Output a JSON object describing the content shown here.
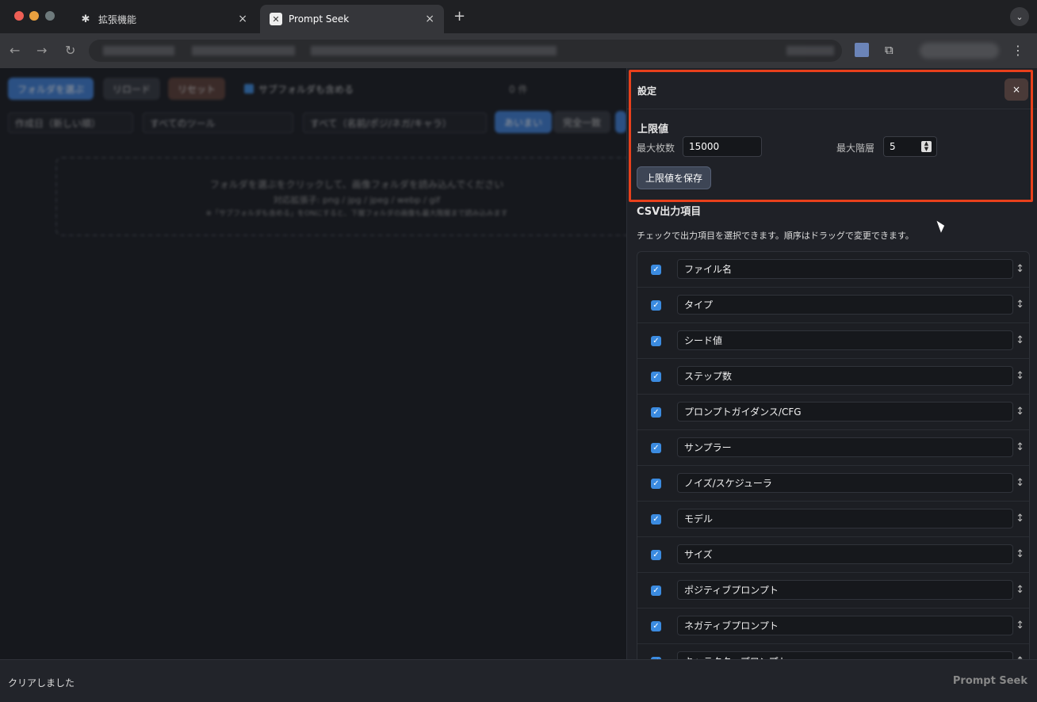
{
  "browser": {
    "tabs": [
      {
        "label": "拡張機能",
        "icon": "puzzle-icon"
      },
      {
        "label": "Prompt Seek",
        "icon": "prompt-seek-icon"
      }
    ],
    "new_tab": "+",
    "tab_close": "×"
  },
  "app_toolbar": {
    "choose_folder": "フォルダを選ぶ",
    "reload": "リロード",
    "reset": "リセット",
    "include_subfolders": "サブフォルダも含める",
    "count": "0 件",
    "sort": "作成日（新しい順）",
    "tool_filter": "すべてのツール",
    "scope_filter": "すべて（名前/ポジ/ネガ/キャラ）",
    "match_partial": "あいまい",
    "match_exact": "完全一致"
  },
  "dropzone": {
    "line1": "フォルダを選ぶをクリックして、画像フォルダを読み込んでください",
    "line2": "対応拡張子: png / jpg / jpeg / webp / gif",
    "line3": "※「サブフォルダも含める」をONにすると、下層フォルダの画像も最大階層まで読み込みます"
  },
  "settings": {
    "title": "設定",
    "close": "×",
    "limit_heading": "上限値",
    "max_count_label": "最大枚数",
    "max_count_value": "15000",
    "max_depth_label": "最大階層",
    "max_depth_value": "5",
    "save_label": "上限値を保存",
    "csv_heading": "CSV出力項目",
    "csv_note": "チェックで出力項目を選択できます。順序はドラッグで変更できます。",
    "csv_fields": [
      {
        "label": "ファイル名",
        "checked": true
      },
      {
        "label": "タイプ",
        "checked": true
      },
      {
        "label": "シード値",
        "checked": true
      },
      {
        "label": "ステップ数",
        "checked": true
      },
      {
        "label": "プロンプトガイダンス/CFG",
        "checked": true
      },
      {
        "label": "サンプラー",
        "checked": true
      },
      {
        "label": "ノイズ/スケジューラ",
        "checked": true
      },
      {
        "label": "モデル",
        "checked": true
      },
      {
        "label": "サイズ",
        "checked": true
      },
      {
        "label": "ポジティブプロンプト",
        "checked": true
      },
      {
        "label": "ネガティブプロンプト",
        "checked": true
      },
      {
        "label": "キャラクタープロンプト",
        "checked": true
      }
    ]
  },
  "status_bar": {
    "message": "クリアしました",
    "brand": "Prompt Seek"
  }
}
